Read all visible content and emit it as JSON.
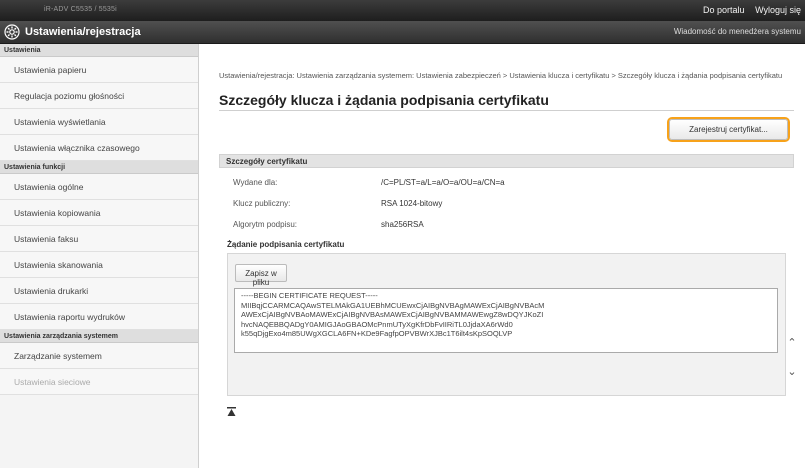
{
  "topbar": {
    "device_name": "iR-ADV C5535 / 5535i",
    "portal_link": "Do portalu",
    "logout_link": "Wyloguj się"
  },
  "header": {
    "title": "Ustawienia/rejestracja",
    "message_link": "Wiadomość do menedżera systemu"
  },
  "sidebar": {
    "sections": [
      {
        "label": "Ustawienia",
        "items": [
          "Ustawienia papieru",
          "Regulacja poziomu głośności",
          "Ustawienia wyświetlania",
          "Ustawienia włącznika czasowego"
        ]
      },
      {
        "label": "Ustawienia funkcji",
        "items": [
          "Ustawienia ogólne",
          "Ustawienia kopiowania",
          "Ustawienia faksu",
          "Ustawienia skanowania",
          "Ustawienia drukarki",
          "Ustawienia raportu wydruków"
        ]
      },
      {
        "label": "Ustawienia zarządzania systemem",
        "items": [
          "Zarządzanie systemem",
          "Ustawienia sieciowe"
        ]
      }
    ]
  },
  "main": {
    "breadcrumb": "Ustawienia/rejestracja: Ustawienia zarządzania systemem: Ustawienia zabezpieczeń > Ustawienia klucza i certyfikatu > Szczegóły klucza i żądania podpisania certyfikatu",
    "page_title": "Szczegóły klucza i żądania podpisania certyfikatu",
    "register_button": "Zarejestruj certyfikat...",
    "details_header": "Szczegóły certyfikatu",
    "details": [
      {
        "label": "Wydane dla:",
        "value": "/C=PL/ST=a/L=a/O=a/OU=a/CN=a"
      },
      {
        "label": "Klucz publiczny:",
        "value": "RSA 1024-bitowy"
      },
      {
        "label": "Algorytm podpisu:",
        "value": "sha256RSA"
      }
    ],
    "csr_title": "Żądanie podpisania certyfikatu",
    "save_button": "Zapisz w pliku",
    "csr_text": "-----BEGIN CERTIFICATE REQUEST-----\nMIIBqjCCARMCAQAwSTELMAkGA1UEBhMCUEwxCjAIBgNVBAgMAWExCjAIBgNVBAcM\nAWExCjAIBgNVBAoMAWExCjAIBgNVBAsMAWExCjAIBgNVBAMMAWEwgZ8wDQYJKoZI\nhvcNAQEBBQADgY0AMIGJAoGBAOMcPnmUTyXgKfrDbFvIIRiTL0JjdaXA6rWd0\nk55qDjgExo4m85UWgXGCLA6FN+KDe9FagfpOPVBWrXJBc1T6ilt4sKpSOQLVP",
    "colors": {
      "register_highlight": "#f7a21a",
      "topbar": "#2a2a2a",
      "section_header": "#e3e3e3"
    },
    "icons": {
      "header": "gear-icon",
      "top_anchor": "arrow-to-top-icon"
    }
  }
}
